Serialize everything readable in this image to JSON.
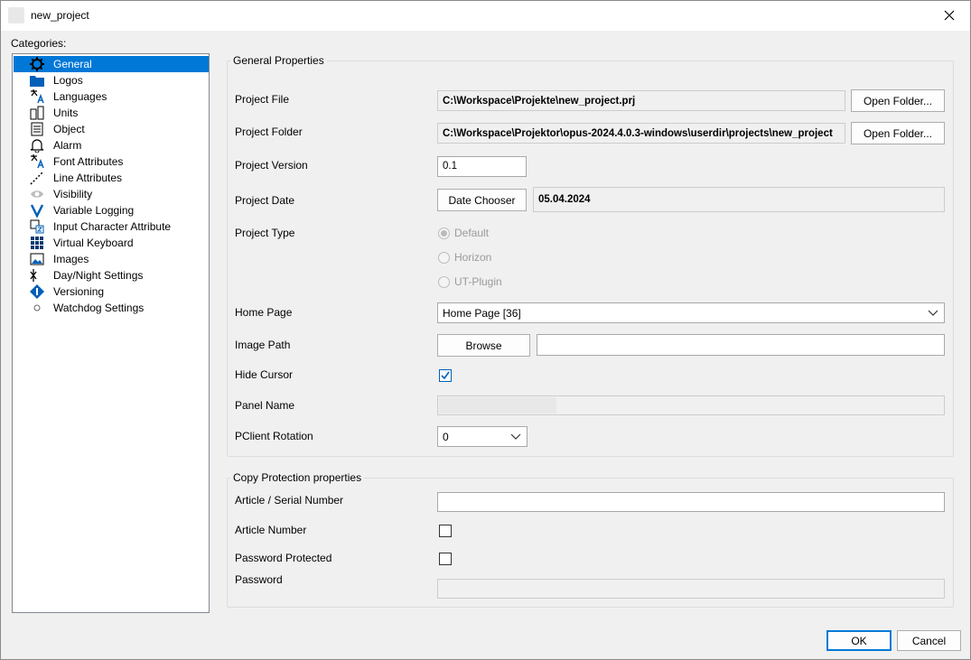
{
  "window": {
    "title": "new_project"
  },
  "categories": {
    "label": "Categories:",
    "items": [
      {
        "label": "General",
        "icon": "gear-icon"
      },
      {
        "label": "Logos",
        "icon": "folder-icon"
      },
      {
        "label": "Languages",
        "icon": "translate-icon"
      },
      {
        "label": "Units",
        "icon": "units-icon"
      },
      {
        "label": "Object",
        "icon": "document-icon"
      },
      {
        "label": "Alarm",
        "icon": "bell-icon"
      },
      {
        "label": "Font Attributes",
        "icon": "font-icon"
      },
      {
        "label": "Line Attributes",
        "icon": "dotted-line-icon"
      },
      {
        "label": "Visibility",
        "icon": "eye-icon"
      },
      {
        "label": "Variable Logging",
        "icon": "v-icon"
      },
      {
        "label": "Input Character Attribute",
        "icon": "input-char-icon"
      },
      {
        "label": "Virtual Keyboard",
        "icon": "keyboard-icon"
      },
      {
        "label": "Images",
        "icon": "image-icon"
      },
      {
        "label": "Day/Night Settings",
        "icon": "day-night-icon"
      },
      {
        "label": "Versioning",
        "icon": "versioning-icon"
      },
      {
        "label": "Watchdog Settings",
        "icon": "dot-icon"
      }
    ],
    "selected": "General"
  },
  "general": {
    "legend": "General Properties",
    "project_file": {
      "label": "Project File",
      "value": "C:\\Workspace\\Projekte\\new_project.prj",
      "button": "Open Folder..."
    },
    "project_folder": {
      "label": "Project Folder",
      "value": "C:\\Workspace\\Projektor\\opus-2024.4.0.3-windows\\userdir\\projects\\new_project",
      "button": "Open Folder..."
    },
    "project_version": {
      "label": "Project Version",
      "value": "0.1"
    },
    "project_date": {
      "label": "Project Date",
      "button": "Date Chooser",
      "value": "05.04.2024"
    },
    "project_type": {
      "label": "Project Type",
      "options": [
        "Default",
        "Horizon",
        "UT-Plugin"
      ],
      "selected": "Default"
    },
    "home_page": {
      "label": "Home Page",
      "value": "Home Page [36]"
    },
    "image_path": {
      "label": "Image Path",
      "button": "Browse",
      "value": ""
    },
    "hide_cursor": {
      "label": "Hide Cursor",
      "checked": true
    },
    "panel_name": {
      "label": "Panel Name"
    },
    "pclient_rotation": {
      "label": "PClient Rotation",
      "value": "0"
    }
  },
  "copy_protection": {
    "legend": "Copy Protection properties",
    "article_serial": {
      "label": "Article / Serial Number",
      "value": ""
    },
    "article_number": {
      "label": "Article Number",
      "checked": false
    },
    "password_protected": {
      "label": "Password Protected",
      "checked": false
    },
    "password": {
      "label": "Password"
    }
  },
  "buttons": {
    "ok": "OK",
    "cancel": "Cancel"
  },
  "colors": {
    "selection": "#0078d7",
    "accent_icon": "#005fb8"
  }
}
